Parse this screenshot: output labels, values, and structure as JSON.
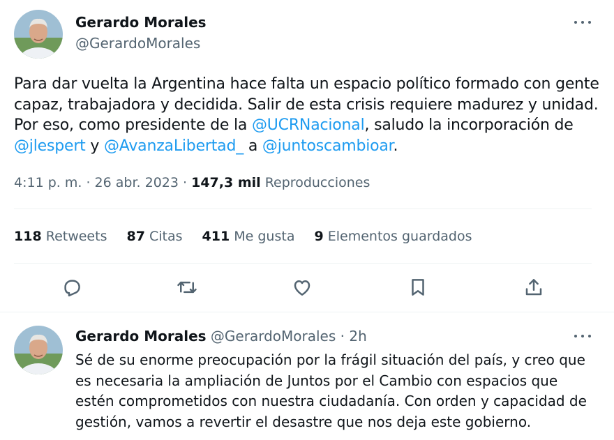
{
  "tweet": {
    "author_name": "Gerardo Morales",
    "author_handle": "@GerardoMorales",
    "text_parts": [
      "Para dar vuelta la Argentina hace falta un espacio político formado con gente capaz, trabajadora y decidida. Salir de esta crisis requiere madurez y unidad. Por eso, como presidente de la ",
      ", saludo la incorporación de ",
      " y ",
      " a ",
      "."
    ],
    "mentions": [
      "@UCRNacional",
      "@jlespert",
      "@AvanzaLibertad_",
      "@juntoscambioar"
    ],
    "time": "4:11 p. m.",
    "date": "26 abr. 2023",
    "separator": "·",
    "views_count": "147,3 mil",
    "views_label": "Reproducciones"
  },
  "stats": [
    {
      "count": "118",
      "label": "Retweets"
    },
    {
      "count": "87",
      "label": "Citas"
    },
    {
      "count": "411",
      "label": "Me gusta"
    },
    {
      "count": "9",
      "label": "Elementos guardados"
    }
  ],
  "actions": [
    {
      "name": "reply-icon"
    },
    {
      "name": "retweet-icon"
    },
    {
      "name": "like-icon"
    },
    {
      "name": "bookmark-icon"
    },
    {
      "name": "share-icon"
    }
  ],
  "reply": {
    "author_name": "Gerardo Morales",
    "author_handle": "@GerardoMorales",
    "separator": "·",
    "time_ago": "2h",
    "text": "Sé de su enorme preocupación por la frágil situación del país, y creo que es necesaria la ampliación de Juntos por el Cambio con espacios que estén comprometidos con nuestra ciudadanía. Con orden y capacidad de gestión, vamos a revertir el desastre que nos deja este gobierno."
  },
  "colors": {
    "text": "#0f1419",
    "secondary": "#536471",
    "link": "#1d9bf0",
    "divider": "#eff3f4"
  }
}
